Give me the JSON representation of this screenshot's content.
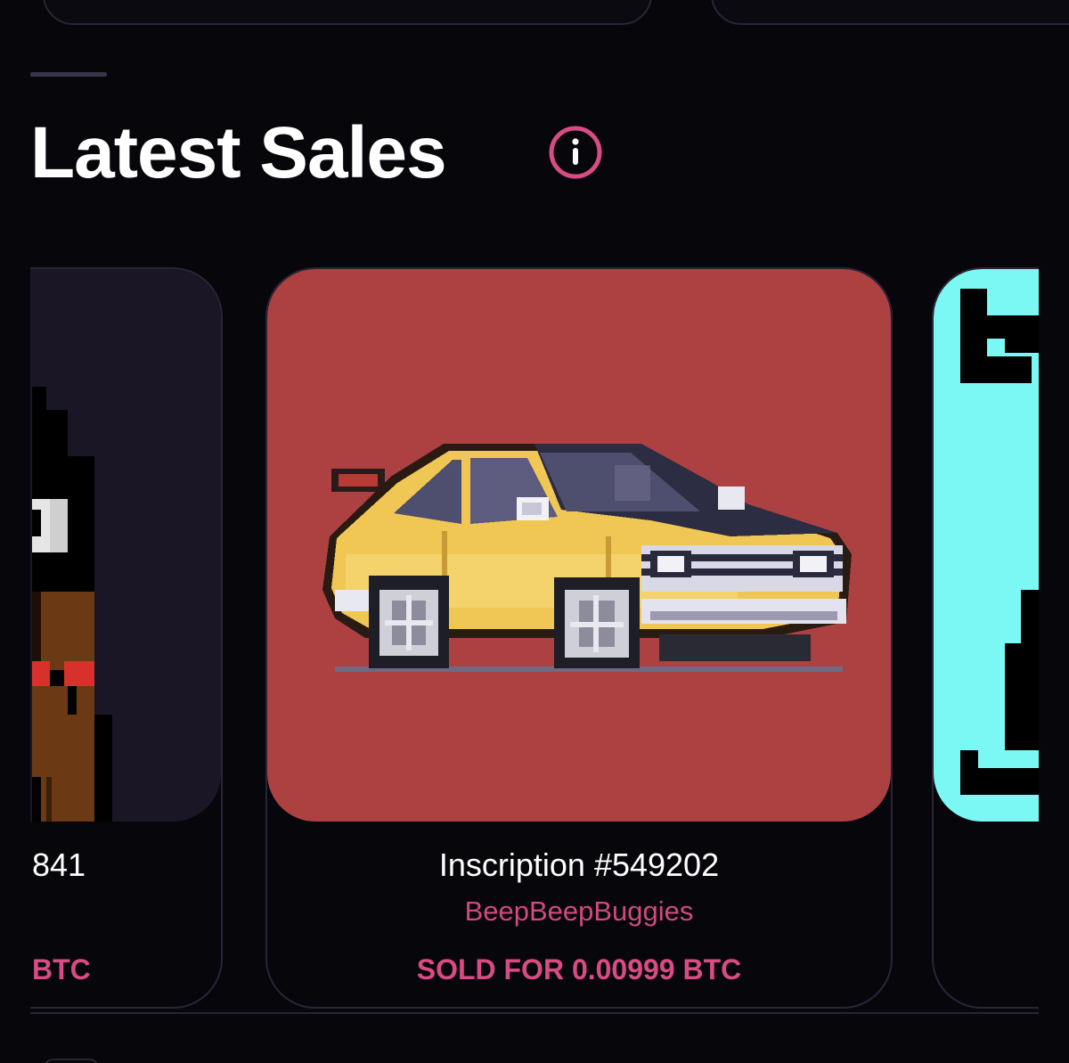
{
  "section": {
    "title": "Latest Sales",
    "info_icon": "info-circle-icon",
    "accent_color": "#d84b84"
  },
  "sales": [
    {
      "title_fragment": "841",
      "price_fragment": "BTC",
      "image_bg": "#1b1626",
      "image": "pixel-character-art"
    },
    {
      "title": "Inscription #549202",
      "collection": "BeepBeepBuggies",
      "price_label": "SOLD FOR 0.00999 BTC",
      "image_bg": "#ad4142",
      "image": "pixel-yellow-car-art"
    },
    {
      "image_bg": "#7cf8f4",
      "image": "pixel-cyan-art"
    }
  ]
}
